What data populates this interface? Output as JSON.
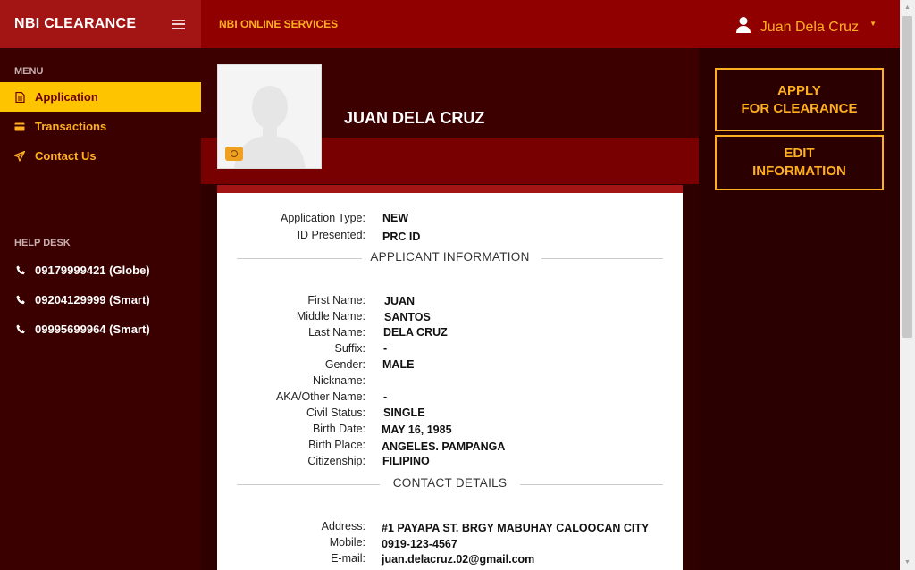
{
  "brand": {
    "title": "NBI CLEARANCE"
  },
  "topbar": {
    "title": "NBI ONLINE SERVICES",
    "user_name": "Juan Dela Cruz"
  },
  "sidebar": {
    "menu_label": "MENU",
    "items": [
      {
        "label": "Application",
        "icon": "document-icon",
        "active": true
      },
      {
        "label": "Transactions",
        "icon": "card-icon",
        "active": false
      },
      {
        "label": "Contact Us",
        "icon": "send-icon",
        "active": false
      }
    ],
    "help_label": "HELP DESK",
    "help_items": [
      {
        "label": "09179999421 (Globe)"
      },
      {
        "label": "09204129999 (Smart)"
      },
      {
        "label": "09995699964 (Smart)"
      }
    ]
  },
  "profile": {
    "name": "JUAN DELA CRUZ"
  },
  "application": {
    "type_label": "Application Type:",
    "type_value": "NEW",
    "id_label": "ID Presented:",
    "id_value": "PRC ID"
  },
  "sections": {
    "applicant": "APPLICANT INFORMATION",
    "contact": "CONTACT DETAILS"
  },
  "applicant_fields": [
    {
      "label": "First Name:",
      "value": "JUAN"
    },
    {
      "label": "Middle Name:",
      "value": "SANTOS"
    },
    {
      "label": "Last Name:",
      "value": "DELA CRUZ"
    },
    {
      "label": "Suffix:",
      "value": "-"
    },
    {
      "label": "Gender:",
      "value": "MALE"
    },
    {
      "label": "Nickname:",
      "value": ""
    },
    {
      "label": "AKA/Other Name:",
      "value": "-"
    },
    {
      "label": "Civil Status:",
      "value": "SINGLE"
    },
    {
      "label": "Birth Date:",
      "value": "MAY 16, 1985"
    },
    {
      "label": "Birth Place:",
      "value": "ANGELES. PAMPANGA"
    },
    {
      "label": "Citizenship:",
      "value": "FILIPINO"
    }
  ],
  "contact_fields": [
    {
      "label": "Address:",
      "value": "#1 PAYAPA ST. BRGY MABUHAY CALOOCAN CITY"
    },
    {
      "label": "Mobile:",
      "value": "0919-123-4567"
    },
    {
      "label": "E-mail:",
      "value": "juan.delacruz.02@gmail.com"
    }
  ],
  "actions": {
    "apply_line1": "APPLY",
    "apply_line2": "FOR CLEARANCE",
    "edit_line1": "EDIT",
    "edit_line2": "INFORMATION"
  },
  "colors": {
    "brand_red": "#a31515",
    "accent_yellow": "#ffc400",
    "accent_orange": "#ffb020",
    "dark_maroon": "#2a0000"
  }
}
